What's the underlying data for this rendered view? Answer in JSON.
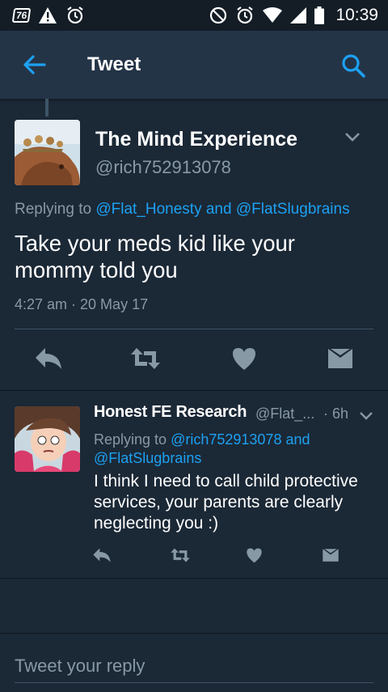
{
  "status_bar": {
    "notification_badge": "76",
    "time": "10:39",
    "left_icons": [
      "notification-76-icon",
      "warning-icon",
      "alarm-icon"
    ],
    "right_icons": [
      "do-not-disturb-icon",
      "alarm-icon",
      "wifi-icon",
      "signal-icon",
      "battery-icon"
    ]
  },
  "app_bar": {
    "title": "Tweet",
    "back_icon": "arrow-left-icon",
    "search_icon": "search-icon"
  },
  "main_tweet": {
    "author_name": "The Mind Experience",
    "author_handle": "@rich752913078",
    "replying_prefix": "Replying to",
    "replying_to": "@Flat_Honesty and @FlatSlugbrains",
    "text": "Take your meds kid like your mommy told you",
    "timestamp": "4:27 am · 20 May 17",
    "actions": [
      "reply-icon",
      "retweet-icon",
      "like-icon",
      "direct-message-icon"
    ]
  },
  "reply_tweet": {
    "author_name": "Honest FE Research",
    "author_handle": "@Flat_...",
    "time": "· 6h",
    "replying_prefix": "Replying to",
    "replying_to": "@rich752913078 and @FlatSlugbrains",
    "text": "I think I need to call child protective services, your parents are clearly neglecting you :)",
    "actions": [
      "reply-icon",
      "retweet-icon",
      "like-icon",
      "direct-message-icon"
    ]
  },
  "composer": {
    "placeholder": "Tweet your reply",
    "value": ""
  },
  "colors": {
    "background": "#1b2836",
    "app_bar": "#243447",
    "status_bar": "#141d26",
    "accent": "#1da1f2",
    "secondary_text": "#8899a6"
  }
}
